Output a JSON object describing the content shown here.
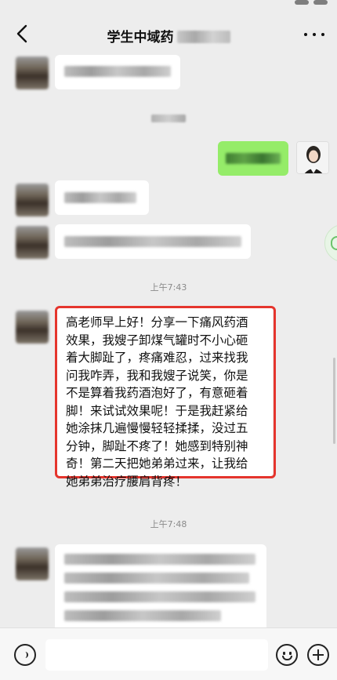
{
  "header": {
    "title": "学生中域药"
  },
  "timestamps": {
    "t1": "上午7:43",
    "t2": "上午7:48"
  },
  "highlighted_message": {
    "text": "高老师早上好！分享一下痛风药酒\n效果，我嫂子卸煤气罐时不小心砸\n着大脚趾了，疼痛难忍，过来找我\n问我咋弄，我和我嫂子说笑，你是\n不是算着我药酒泡好了，有意砸着\n脚！来试试效果呢！于是我赶紧给\n她涂抹几遍慢慢轻轻揉揉，没过五\n分钟，脚趾不疼了！她感到特别神\n奇！第二天把她弟弟过来，让我给\n她弟弟治疗腰肩背疼！",
    "highlight_color": "#e5352d"
  },
  "colors": {
    "background": "#ededed",
    "my_bubble": "#95ec69",
    "other_bubble": "#ffffff"
  },
  "icons": {
    "back": "chevron-left-icon",
    "more": "more-dots-icon",
    "voice": "voice-icon",
    "emoji": "emoji-icon",
    "plus": "plus-icon"
  }
}
